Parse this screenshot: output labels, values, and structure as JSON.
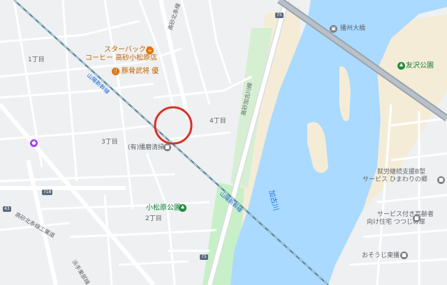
{
  "pois": {
    "starbucks_line1": "スターバックス",
    "starbucks_line2": "コーヒー 高砂小松原店",
    "tonkatsu": "豚骨武将 優",
    "harima_bridge": "播州大橋",
    "yuzawa_park": "友沢公園",
    "cleaning": "(有)播磨清掃",
    "komatsubara_park": "小松原公園",
    "welfare_line1": "就労継続支援B型",
    "welfare_line2": "サービス ひまわりの郷",
    "elder_line1": "サービス付き高齢者",
    "elder_line2": "向け住宅 つつじの扉",
    "osouji": "おそうじ東播"
  },
  "areas": {
    "chome1": "1丁目",
    "chome2": "2丁目",
    "chome3": "3丁目",
    "chome4": "4丁目"
  },
  "roads": {
    "takasago_kita_line": "高砂北条線",
    "sanyo_line_1": "山陽新幹線",
    "sanyo_line_2": "山陽新幹線",
    "takasago_kakogawa_line": "高砂加古川線",
    "hamate_line": "浜手東部線",
    "prefectural_line": "高砂北条線工業道"
  },
  "river": {
    "name": "加古川"
  },
  "route_shields": {
    "r75_top": "75",
    "r75_bottom": "75",
    "r718": "718",
    "r43": "43"
  },
  "colors": {
    "water": "#aadaff",
    "park": "#c8f0c8",
    "sand": "#f5ecd7",
    "road": "#ffffff",
    "highway": "#9aa4ae",
    "rail": "#5e8ea0",
    "marker": "#d93025"
  }
}
